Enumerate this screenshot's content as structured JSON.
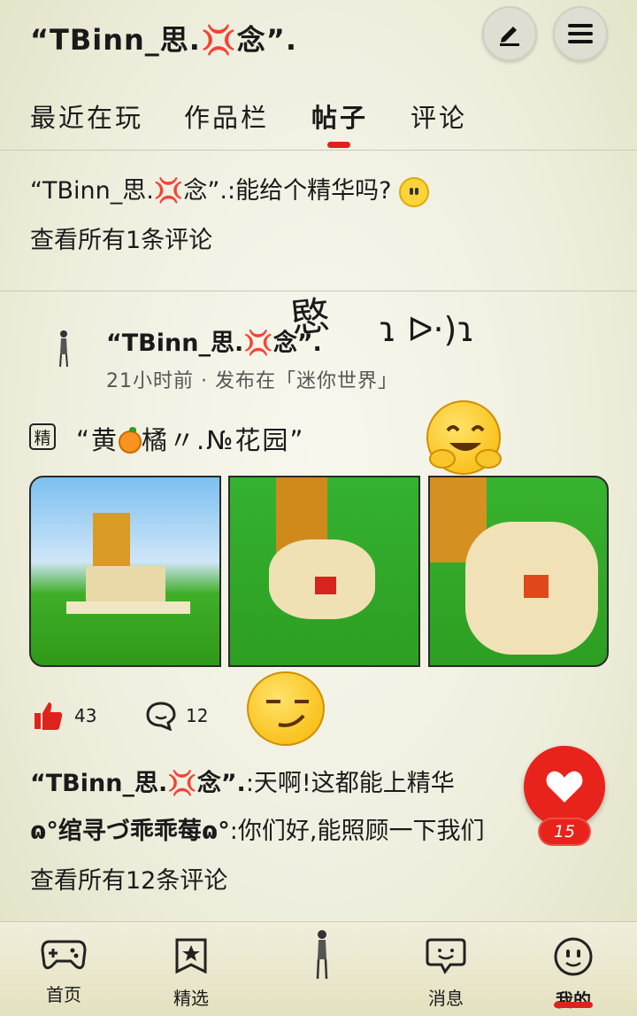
{
  "header": {
    "title": "“TBinn_思.💢念”.",
    "edit_icon": "pencil-icon",
    "menu_icon": "hamburger-icon"
  },
  "tabs": [
    {
      "label": "最近在玩"
    },
    {
      "label": "作品栏"
    },
    {
      "label": "帖子",
      "active": true
    },
    {
      "label": "评论"
    }
  ],
  "comment_block_1": {
    "author": "“TBinn_思.💢念”.",
    "text": ":能给个精华吗?",
    "view_all": "查看所有1条评论"
  },
  "post": {
    "author": "“TBinn_思.💢念”.",
    "decoration": "愍",
    "decoration_face": "ɿ ᐅ·)ɿ",
    "meta": "21小时前 · 发布在「迷你世界」",
    "badge": "精",
    "title_pre": "“黄",
    "title_post": "橘〃.№花园”",
    "likes": "43",
    "comments": "12"
  },
  "comments_preview": [
    {
      "author": "“TBinn_思.💢念”.",
      "text": ":天啊!这都能上精华"
    },
    {
      "author": "ɷ°绾寻づ乖乖莓ɷ°",
      "text": ":你们好,能照顾一下我们"
    }
  ],
  "view_all_2": "查看所有12条评论",
  "fab": {
    "count": "15",
    "icon": "heart-icon"
  },
  "bottom_nav": [
    {
      "label": "首页",
      "icon": "gamepad-icon"
    },
    {
      "label": "精选",
      "icon": "star-bookmark-icon"
    },
    {
      "label": "",
      "icon": "figure-icon"
    },
    {
      "label": "消息",
      "icon": "chat-bubble-icon"
    },
    {
      "label": "我的",
      "icon": "smiley-icon",
      "active": true
    }
  ],
  "colors": {
    "accent": "#e0221c",
    "background": "#f2f2e6"
  }
}
